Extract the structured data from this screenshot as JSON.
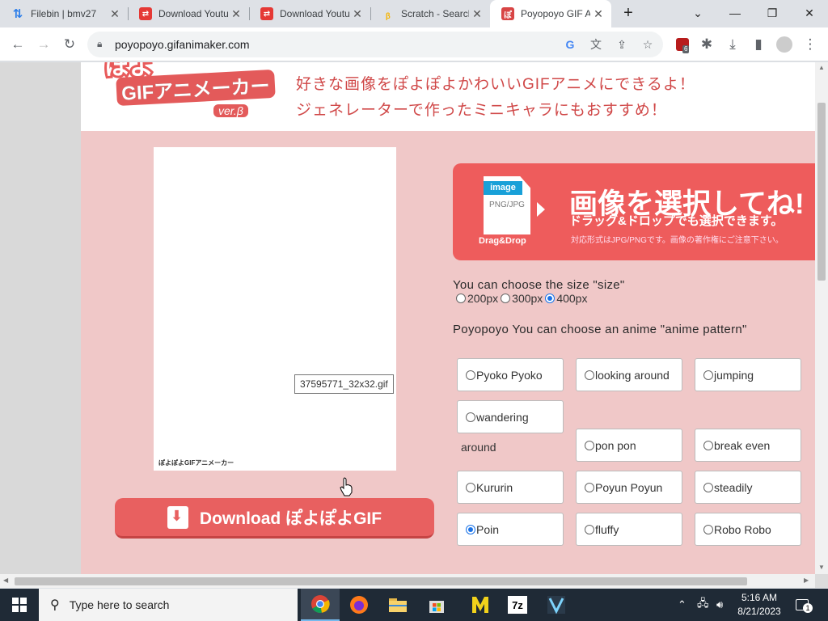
{
  "browser": {
    "tabs": [
      {
        "title": "Filebin | bmv27",
        "favicon": "up-down-arrows",
        "color": "#2b7de9"
      },
      {
        "title": "Download Youtu",
        "favicon": "youtube-downloader",
        "color": "#e53935"
      },
      {
        "title": "Download Youtu",
        "favicon": "youtube-downloader",
        "color": "#e53935"
      },
      {
        "title": "Scratch - Search",
        "favicon": "bing",
        "color": "#f5b400"
      },
      {
        "title": "Poyopoyo GIF A",
        "favicon": "poyopoyo",
        "color": "#d84545"
      }
    ],
    "new_tab": "+",
    "url": "poyopoyo.gifanimaker.com",
    "extension_badge": "6"
  },
  "page": {
    "logo": {
      "top": "ぽよ",
      "main": "GIFアニメーカー",
      "version": "ver.β"
    },
    "tagline_1": "好きな画像をぽよぽよかわいいGIFアニメにできるよ！",
    "tagline_2": "ジェネレーターで作ったミニキャラにもおすすめ！",
    "preview_watermark": "ぽよぽよGIFアニメーカー",
    "tooltip": "37595771_32x32.gif",
    "download_label": "Download ぽよぽよGIF",
    "selector": {
      "tag": "image",
      "formats": "PNG/JPG",
      "drag_drop": "Drag&Drop",
      "headline": "画像を選択してね!",
      "subline": "ドラッグ&ドロップでも選択できます。",
      "note": "対応形式はJPG/PNGです。画像の著作権にご注意下さい。"
    },
    "size_label": "You can choose the size \"size\"",
    "sizes": [
      {
        "label": "200px",
        "selected": false
      },
      {
        "label": "300px",
        "selected": false
      },
      {
        "label": "400px",
        "selected": true
      }
    ],
    "pattern_label": "Poyopoyo You can choose an anime \"anime pattern\"",
    "patterns": {
      "pyoko": "Pyoko Pyoko",
      "looking": "looking around",
      "jumping": "jumping",
      "wandering": "wandering",
      "around": "around",
      "ponpon": "pon pon",
      "breakeven": "break even",
      "kururin": "Kururin",
      "poyun": "Poyun Poyun",
      "steadily": "steadily",
      "poin": "Poin",
      "fluffy": "fluffy",
      "robo": "Robo Robo"
    },
    "selected_pattern": "Poin"
  },
  "taskbar": {
    "search_placeholder": "Type here to search",
    "time": "5:16 AM",
    "date": "8/21/2023",
    "notification_count": "1"
  }
}
